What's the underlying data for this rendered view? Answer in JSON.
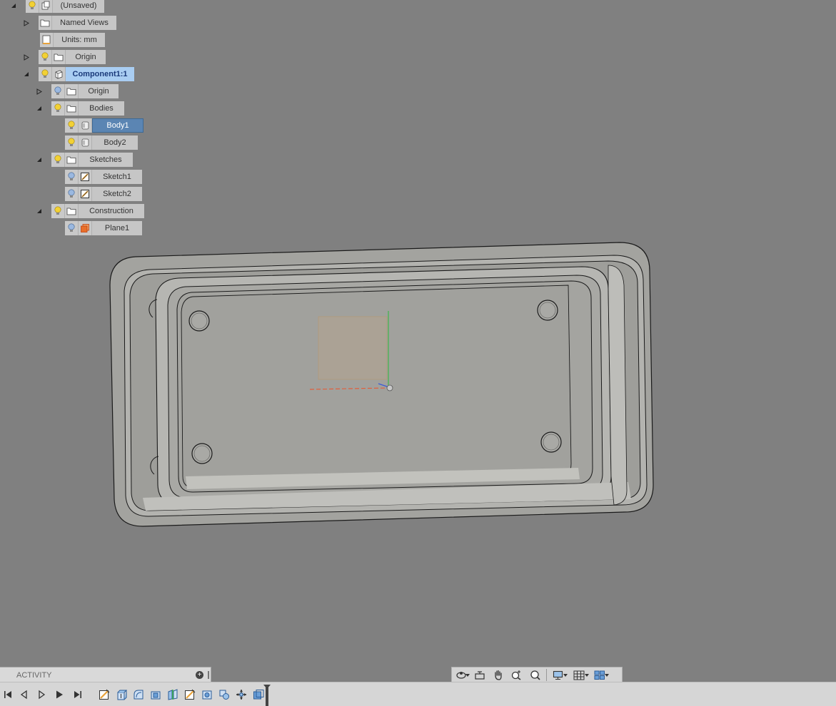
{
  "browser": {
    "root_label": "(Unsaved)",
    "named_views_label": "Named Views",
    "units_label": "Units: mm",
    "origin_label": "Origin",
    "component_label": "Component1:1",
    "component_origin_label": "Origin",
    "bodies_label": "Bodies",
    "body1_label": "Body1",
    "body2_label": "Body2",
    "sketches_label": "Sketches",
    "sketch1_label": "Sketch1",
    "sketch2_label": "Sketch2",
    "construction_label": "Construction",
    "plane1_label": "Plane1"
  },
  "activity": {
    "label": "ACTIVITY"
  },
  "navbar": {
    "tools": [
      "orbit-icon",
      "look-at-icon",
      "pan-icon",
      "zoom-icon",
      "fit-icon",
      "display-settings-icon",
      "grid-settings-icon",
      "viewports-icon"
    ]
  },
  "timeline": {
    "controls": [
      "go-to-start-icon",
      "step-back-icon",
      "play-icon",
      "go-to-end-icon"
    ],
    "features": [
      "sketch-feature-icon",
      "extrude-feature-icon",
      "fillet-feature-icon",
      "shell-feature-icon",
      "split-feature-icon",
      "sketch-feature-icon",
      "hole-feature-icon",
      "combine-feature-icon",
      "move-feature-icon",
      "plane-feature-icon"
    ]
  },
  "colors": {
    "canvas": "#808080",
    "model_face": "#a2a29f",
    "selected_row": "#5b85b3",
    "active_component": "#a9cdf2",
    "light_on": "#f2d135",
    "light_off": "#9ab8e0"
  }
}
